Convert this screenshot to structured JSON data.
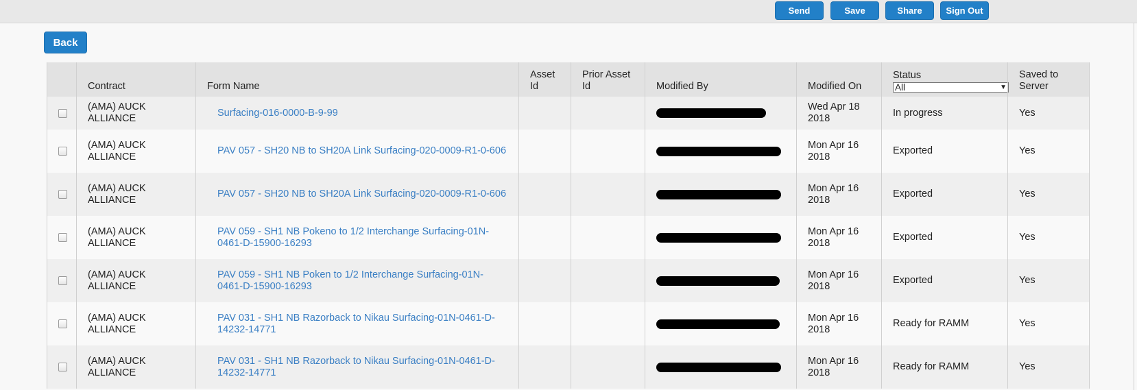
{
  "toolbar": {
    "send_label": "Send",
    "save_label": "Save",
    "share_label": "Share",
    "signout_label": "Sign Out"
  },
  "back_label": "Back",
  "table": {
    "headers": {
      "contract": "Contract",
      "form_name": "Form Name",
      "asset_id": "Asset Id",
      "prior_asset_id": "Prior Asset Id",
      "modified_by": "Modified By",
      "modified_on": "Modified On",
      "status": "Status",
      "saved_to_server": "Saved to Server"
    },
    "status_filter": {
      "selected": "All"
    },
    "rows": [
      {
        "contract": "(AMA) AUCK ALLIANCE",
        "form_name": "Surfacing-016-0000-B-9-99",
        "asset_id": "",
        "prior_asset_id": "",
        "modified_by": "[redacted]",
        "modified_on": "Wed Apr 18 2018",
        "status": "In progress",
        "saved": "Yes"
      },
      {
        "contract": "(AMA) AUCK ALLIANCE",
        "form_name": "PAV 057 - SH20 NB to SH20A Link Surfacing-020-0009-R1-0-606",
        "asset_id": "",
        "prior_asset_id": "",
        "modified_by": "[redacted]",
        "modified_on": "Mon Apr 16 2018",
        "status": "Exported",
        "saved": "Yes"
      },
      {
        "contract": "(AMA) AUCK ALLIANCE",
        "form_name": "PAV 057 - SH20 NB to SH20A Link Surfacing-020-0009-R1-0-606",
        "asset_id": "",
        "prior_asset_id": "",
        "modified_by": "[redacted]",
        "modified_on": "Mon Apr 16 2018",
        "status": "Exported",
        "saved": "Yes"
      },
      {
        "contract": "(AMA) AUCK ALLIANCE",
        "form_name": "PAV 059 - SH1 NB Pokeno to 1/2 Interchange Surfacing-01N-0461-D-15900-16293",
        "asset_id": "",
        "prior_asset_id": "",
        "modified_by": "[redacted]",
        "modified_on": "Mon Apr 16 2018",
        "status": "Exported",
        "saved": "Yes"
      },
      {
        "contract": "(AMA) AUCK ALLIANCE",
        "form_name": "PAV 059 - SH1 NB Poken to 1/2 Interchange Surfacing-01N-0461-D-15900-16293",
        "asset_id": "",
        "prior_asset_id": "",
        "modified_by": "[redacted]",
        "modified_on": "Mon Apr 16 2018",
        "status": "Exported",
        "saved": "Yes"
      },
      {
        "contract": "(AMA) AUCK ALLIANCE",
        "form_name": "PAV 031 - SH1 NB Razorback to Nikau Surfacing-01N-0461-D-14232-14771",
        "asset_id": "",
        "prior_asset_id": "",
        "modified_by": "[redacted]",
        "modified_on": "Mon Apr 16 2018",
        "status": "Ready for RAMM",
        "saved": "Yes"
      },
      {
        "contract": "(AMA) AUCK ALLIANCE",
        "form_name": "PAV 031 - SH1 NB Razorback to Nikau Surfacing-01N-0461-D-14232-14771",
        "asset_id": "",
        "prior_asset_id": "",
        "modified_by": "[redacted]",
        "modified_on": "Mon Apr 16 2018",
        "status": "Ready for RAMM",
        "saved": "Yes"
      }
    ]
  },
  "colors": {
    "button": "#2280c8",
    "link": "#3a7fc4",
    "header_bg": "#e2e2e2",
    "topbar_bg": "#e8e8e8"
  }
}
